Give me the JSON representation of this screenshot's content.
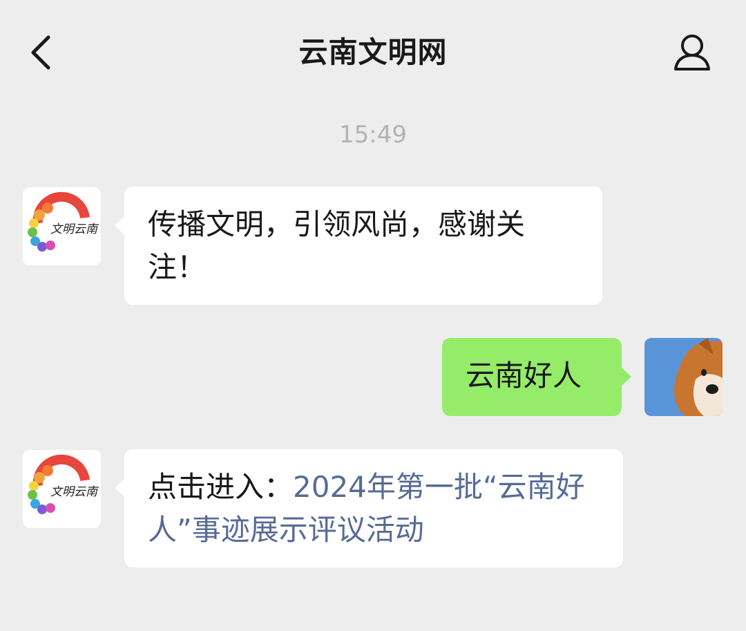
{
  "header": {
    "title": "云南文明网",
    "back_icon": "chevron-left-icon",
    "profile_icon": "person-icon"
  },
  "timestamp": "15:49",
  "messages": [
    {
      "sender": "official",
      "avatar_text": "文明云南",
      "text": "传播文明，引领风尚，感谢关注！"
    },
    {
      "sender": "user",
      "text": "云南好人"
    },
    {
      "sender": "official",
      "avatar_text": "文明云南",
      "prefix": "点击进入：",
      "link_text": "2024年第一批“云南好人”事迹展示评议活动"
    }
  ],
  "colors": {
    "background": "#ededed",
    "incoming_bubble": "#ffffff",
    "outgoing_bubble": "#95ec69",
    "link": "#576b95",
    "timestamp": "#b2b2b2"
  }
}
